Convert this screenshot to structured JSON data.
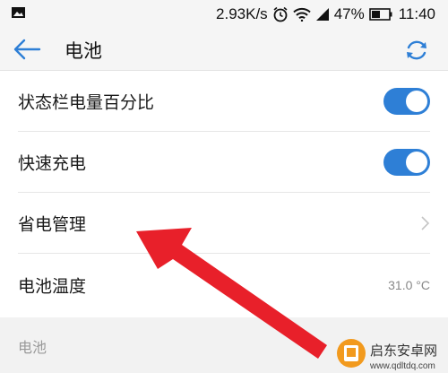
{
  "status_bar": {
    "speed": "2.93K/s",
    "battery_percent": "47%",
    "time": "11:40",
    "icons": [
      "image-icon",
      "alarm-icon",
      "wifi-icon",
      "signal-icon",
      "battery-icon"
    ]
  },
  "appbar": {
    "title": "电池",
    "icons": [
      "back-arrow-icon",
      "refresh-icon"
    ]
  },
  "settings": {
    "items": [
      {
        "label": "状态栏电量百分比",
        "control": "toggle",
        "state": "on"
      },
      {
        "label": "快速充电",
        "control": "toggle",
        "state": "on"
      },
      {
        "label": "省电管理",
        "control": "chevron"
      },
      {
        "label": "电池温度",
        "value": "31.0 °C"
      }
    ]
  },
  "section": {
    "header": "电池"
  },
  "watermark": {
    "text_cn": "启东安卓网",
    "text_url": "www.qdltdq.com"
  },
  "colors": {
    "accent": "#2e7fd6",
    "annotation_arrow": "#e8202a",
    "bar_bg": "#f5f5f5"
  }
}
